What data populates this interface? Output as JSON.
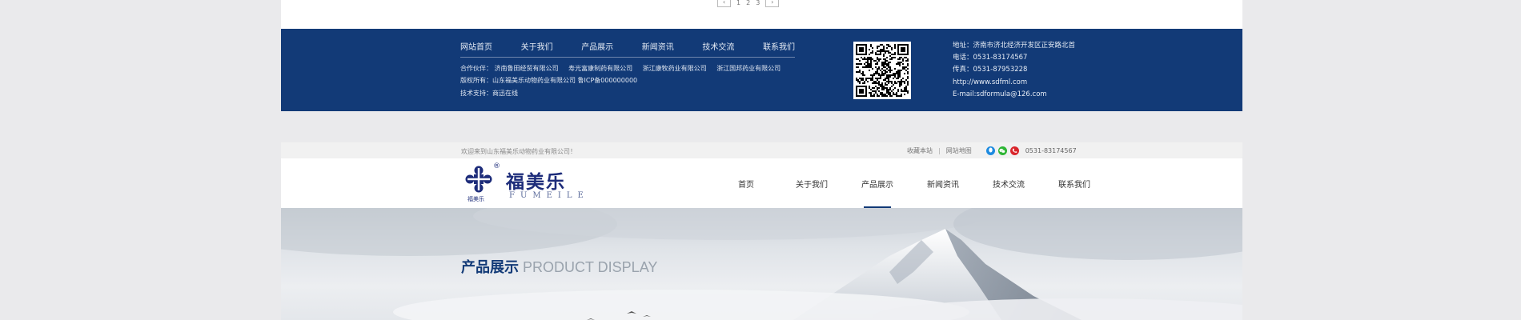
{
  "pager": {
    "prev": "‹",
    "pages": [
      "1",
      "2",
      "3"
    ],
    "next": "›"
  },
  "footer": {
    "nav": [
      "网站首页",
      "关于我们",
      "产品展示",
      "新闻资讯",
      "技术交流",
      "联系我们"
    ],
    "partners_label": "合作伙伴：",
    "partners": [
      "济南鲁田经贸有限公司",
      "寿光富康制药有限公司",
      "浙江康牧药业有限公司",
      "浙江国邦药业有限公司"
    ],
    "copyright": "版权所有：山东福美乐动物药业有限公司  鲁ICP备000000000",
    "tech_support": "技术支持：商迅在线",
    "contact": {
      "address": "地址：济南市济北经济开发区正安路北首",
      "phone": "电话：0531-83174567",
      "fax": "传真：0531-87953228",
      "website": "http://www.sdfml.com",
      "email": "E-mail:sdformula@126.com"
    }
  },
  "topbar": {
    "welcome": "欢迎来到山东福美乐动物药业有限公司！",
    "favorite": "收藏本站",
    "sitemap": "网站地图",
    "phone": "0531-83174567"
  },
  "logo": {
    "cn": "福美乐",
    "en": "FUMEILE",
    "sub": "福美乐",
    "reg": "®"
  },
  "nav": {
    "items": [
      "首页",
      "关于我们",
      "产品展示",
      "新闻资讯",
      "技术交流",
      "联系我们"
    ],
    "active_index": 2
  },
  "banner": {
    "title_cn": "产品展示",
    "title_en": "PRODUCT DISPLAY"
  },
  "icons": {
    "qq": "qq-icon",
    "wechat": "wechat-icon",
    "telephone": "phone-icon"
  },
  "colors": {
    "brand_blue": "#123a77",
    "logo_blue": "#1d2c7a"
  }
}
